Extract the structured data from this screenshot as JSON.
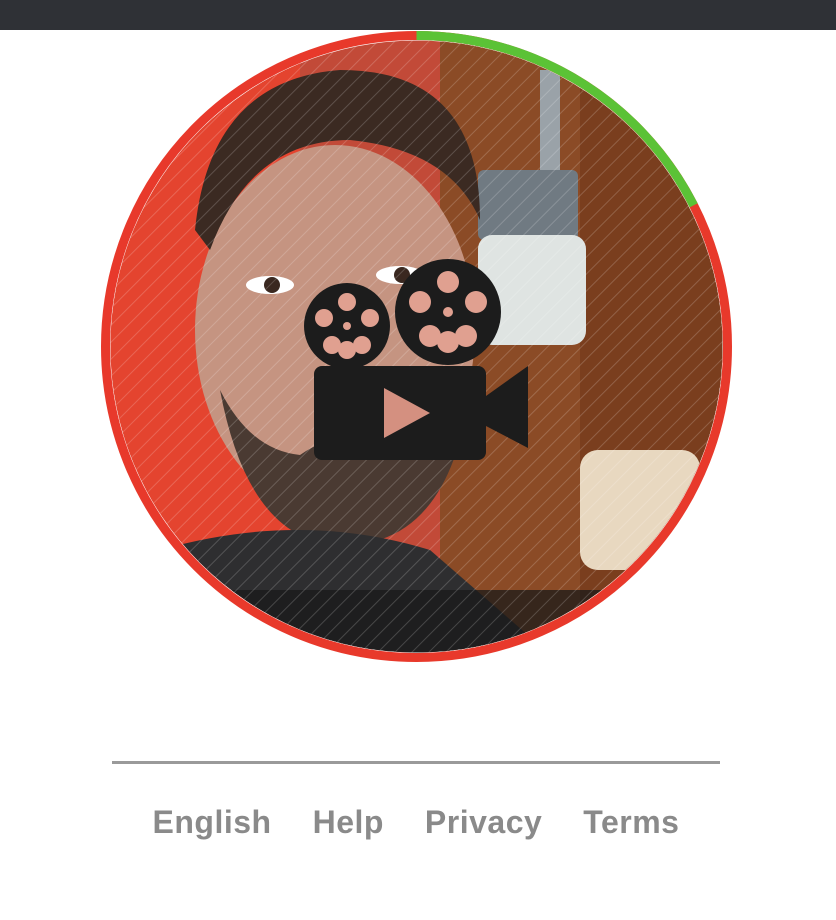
{
  "video_preview": {
    "progress_fraction": 0.175,
    "progress_color": "#5bc236",
    "ring_color": "#e8392b",
    "overlay_icon": "film-camera-icon",
    "ring_width_note": "visual only"
  },
  "footer": {
    "links": [
      {
        "label": "English"
      },
      {
        "label": "Help"
      },
      {
        "label": "Privacy"
      },
      {
        "label": "Terms"
      }
    ]
  }
}
